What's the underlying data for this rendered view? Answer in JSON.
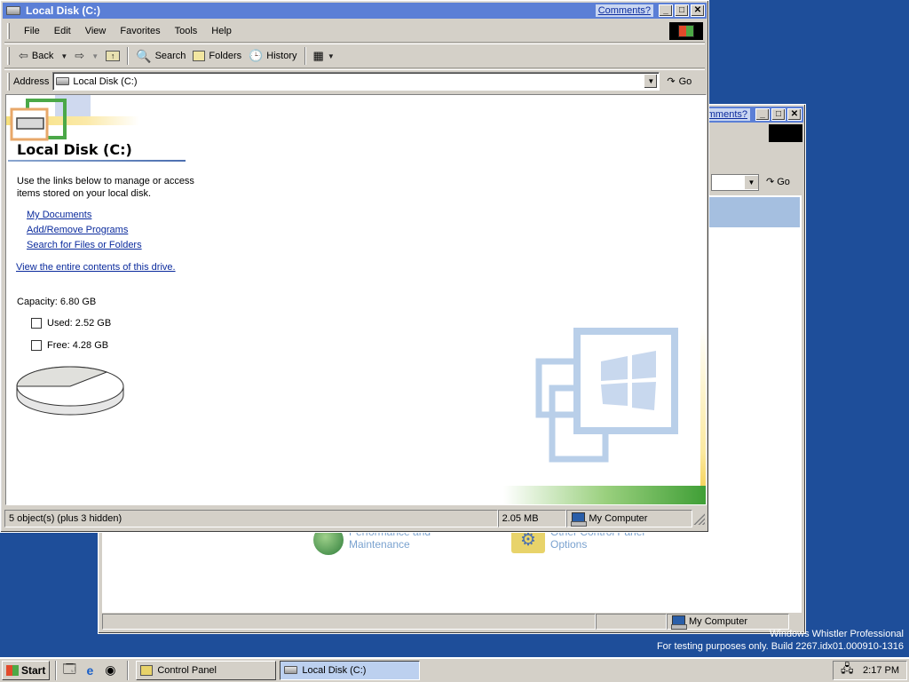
{
  "front": {
    "title": "Local Disk (C:)",
    "comments": "Comments?",
    "menu": [
      "File",
      "Edit",
      "View",
      "Favorites",
      "Tools",
      "Help"
    ],
    "toolbar": {
      "back": "Back",
      "search": "Search",
      "folders": "Folders",
      "history": "History"
    },
    "address": {
      "label": "Address",
      "value": "Local Disk (C:)",
      "go": "Go"
    },
    "content": {
      "title": "Local Disk (C:)",
      "intro": "Use the links below to manage or access items stored on your local disk.",
      "links": [
        "My Documents",
        "Add/Remove Programs",
        "Search for Files or Folders"
      ],
      "view_all": "View the entire contents of this drive.",
      "capacity": "Capacity: 6.80 GB",
      "used": "Used: 2.52 GB",
      "free": "Free: 4.28 GB"
    },
    "status": {
      "objects": "5 object(s) (plus 3 hidden)",
      "size": "2.05 MB",
      "location": "My Computer"
    }
  },
  "back": {
    "comments": "Comments?",
    "go": "Go",
    "categories": [
      {
        "label1": "Performance and",
        "label2": "Maintenance",
        "icon": "performance-icon"
      },
      {
        "label1": "Other Control Panel",
        "label2": "Options",
        "icon": "options-icon"
      }
    ],
    "status_location": "My Computer"
  },
  "disk_usage": {
    "capacity_gb": 6.8,
    "used_gb": 2.52,
    "free_gb": 4.28
  },
  "os_watermark": {
    "line1": "Windows Whistler Professional",
    "line2": "For testing purposes only. Build 2267.idx01.000910-1316"
  },
  "taskbar": {
    "start": "Start",
    "tasks": [
      "Control Panel",
      "Local Disk (C:)"
    ],
    "clock": "2:17 PM"
  },
  "colors": {
    "desktop": "#1e4e9a",
    "titlebar": "#5b7fd6",
    "link": "#0b2b9d"
  }
}
